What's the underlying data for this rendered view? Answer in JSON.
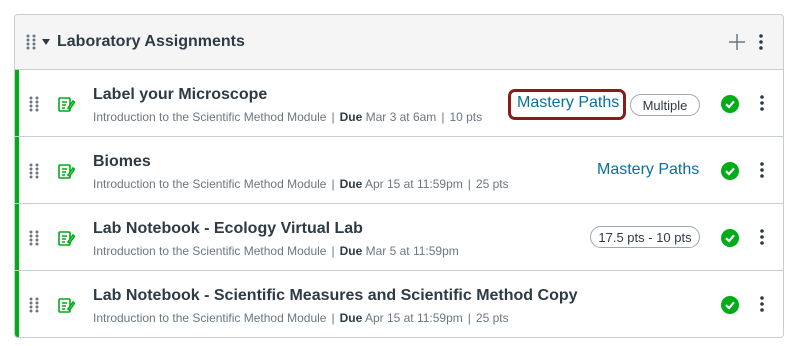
{
  "module": {
    "title": "Laboratory Assignments"
  },
  "items": [
    {
      "title": "Label your Microscope",
      "module_name": "Introduction to the Scientific Method Module",
      "due_label": "Due",
      "due_date": "Mar 3 at 6am",
      "points": "10 pts",
      "mastery_label": "Mastery Paths",
      "pill_label": "Multiple"
    },
    {
      "title": "Biomes",
      "module_name": "Introduction to the Scientific Method Module",
      "due_label": "Due",
      "due_date": "Apr 15 at 11:59pm",
      "points": "25 pts",
      "mastery_label": "Mastery Paths"
    },
    {
      "title": "Lab Notebook - Ecology Virtual Lab",
      "module_name": "Introduction to the Scientific Method Module",
      "due_label": "Due",
      "due_date": "Mar 5 at 11:59pm",
      "pill_label": "17.5 pts - 10 pts"
    },
    {
      "title": "Lab Notebook - Scientific Measures and Scientific Method Copy",
      "module_name": "Introduction to the Scientific Method Module",
      "due_label": "Due",
      "due_date": "Apr 15 at 11:59pm",
      "points": "25 pts"
    }
  ],
  "colors": {
    "published_green": "#00ac18",
    "link_blue": "#0770a3",
    "highlight_red": "#8b1a1a"
  },
  "icons": {
    "drag": "drag-handle-icon",
    "caret": "caret-down-icon",
    "add": "plus-icon",
    "menu": "kebab-menu-icon",
    "assignment": "assignment-icon",
    "published": "check-circle-icon"
  }
}
